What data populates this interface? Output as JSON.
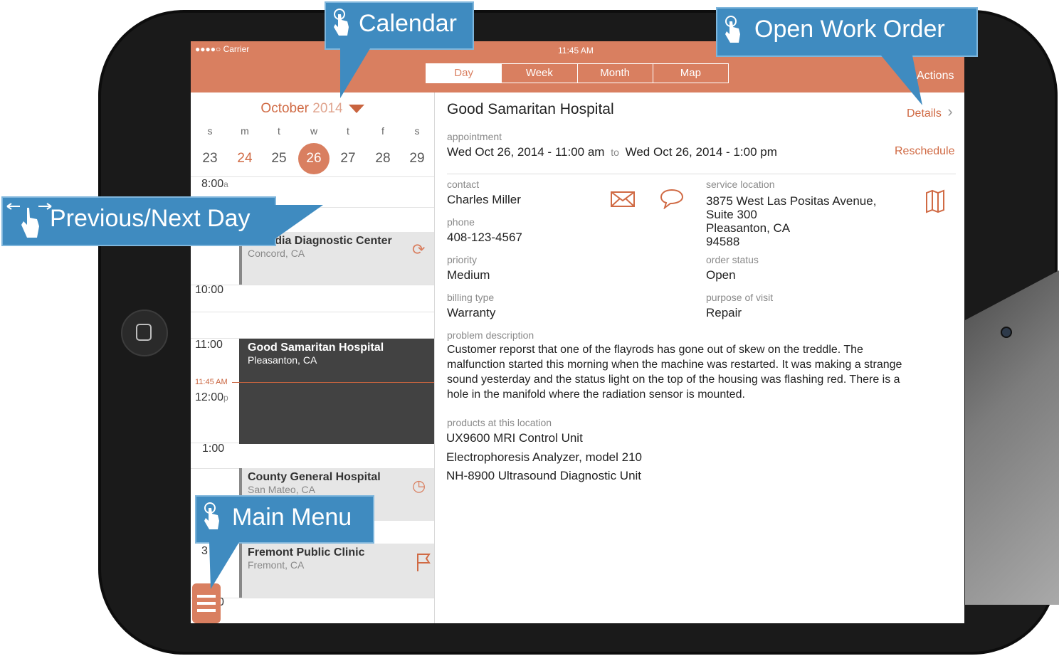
{
  "status_bar": {
    "carrier": "●●●●○ Carrier",
    "time": "11:45 AM"
  },
  "view_tabs": [
    "Day",
    "Week",
    "Month",
    "Map"
  ],
  "actions_label": "Actions",
  "calendar": {
    "month": "October",
    "year": "2014",
    "weekdays": [
      "s",
      "m",
      "t",
      "w",
      "t",
      "f",
      "s"
    ],
    "days": [
      "23",
      "24",
      "25",
      "26",
      "27",
      "28",
      "29"
    ],
    "selected_day": "26"
  },
  "day_view": {
    "hours": {
      "h8": "8:00",
      "h8_suffix": "a",
      "h10": "10:00",
      "h11": "11:00",
      "h12": "12:00",
      "h12_suffix": "p",
      "h1": "1:00",
      "h3": "3",
      "h4": "0"
    },
    "now_label": "11:45 AM",
    "appointments": [
      {
        "title": "...cordia Diagnostic Center",
        "location": "Concord, CA"
      },
      {
        "title": "Good Samaritan Hospital",
        "location": "Pleasanton, CA"
      },
      {
        "title": "County General Hospital",
        "location": "San Mateo, CA"
      },
      {
        "title": "Fremont Public Clinic",
        "location": "Fremont, CA"
      }
    ]
  },
  "detail": {
    "title": "Good Samaritan Hospital",
    "details_link": "Details",
    "appointment_label": "appointment",
    "appointment_start": "Wed Oct 26, 2014 - 11:00 am",
    "to": "to",
    "appointment_end": "Wed Oct 26, 2014 - 1:00 pm",
    "reschedule": "Reschedule",
    "contact_label": "contact",
    "contact": "Charles Miller",
    "phone_label": "phone",
    "phone": "408-123-4567",
    "priority_label": "priority",
    "priority": "Medium",
    "billing_label": "billing type",
    "billing": "Warranty",
    "service_location_label": "service location",
    "address_line1": "3875 West Las Positas Avenue,",
    "address_line2": "Suite 300",
    "address_line3": "Pleasanton, CA",
    "address_line4": "94588",
    "order_status_label": "order status",
    "order_status": "Open",
    "purpose_label": "purpose of visit",
    "purpose": "Repair",
    "problem_label": "problem description",
    "problem_lines": [
      "Customer reporst that one of the flayrods has gone out of skew on the treddle. The",
      "malfunction started this morning when the machine was restarted. It was making a strange",
      "sound yesterday and the status light on the top of the housing was flashing red. There is a",
      "hole in the manifold where the radiation sensor is mounted."
    ],
    "products_label": "products at this location",
    "products": [
      "UX9600 MRI Control Unit",
      "Electrophoresis Analyzer, model 210",
      "NH-8900 Ultrasound Diagnostic Unit"
    ]
  },
  "callouts": {
    "calendar": "Calendar",
    "open_work_order": "Open Work Order",
    "prev_next": "Previous/Next Day",
    "main_menu": "Main Menu"
  },
  "colors": {
    "accent": "#d97f60",
    "callout": "#3f8bc0",
    "appointment_dark": "#424242"
  }
}
